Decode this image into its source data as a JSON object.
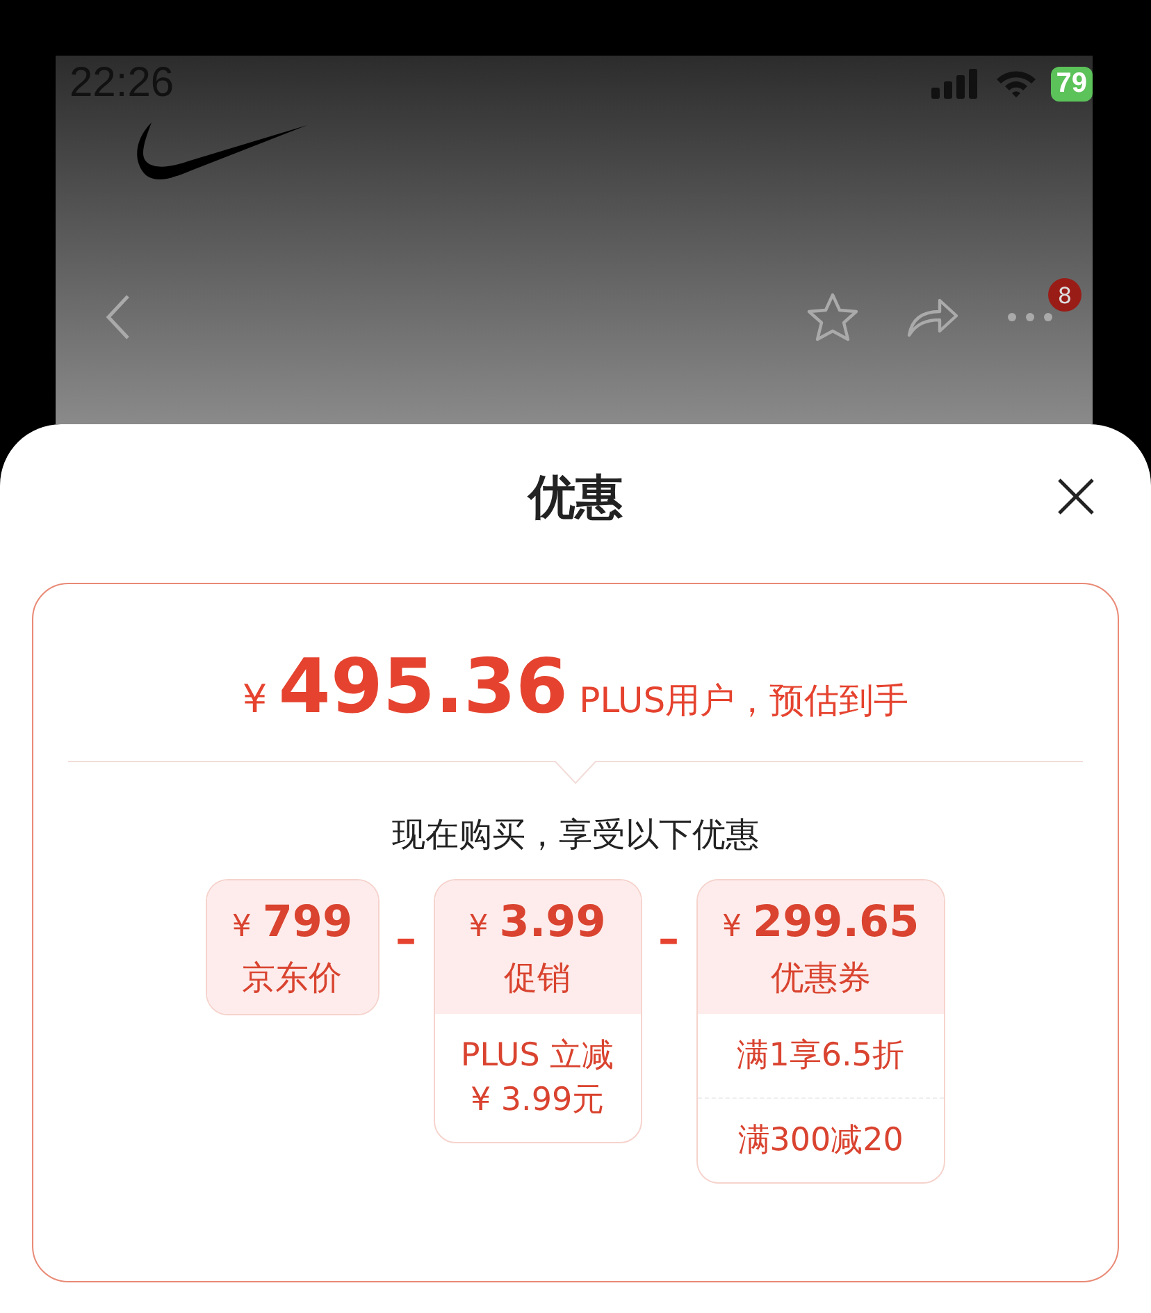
{
  "status_bar": {
    "time": "22:26",
    "battery": "79"
  },
  "nav": {
    "badge": "8"
  },
  "sheet": {
    "title": "优惠",
    "price": {
      "currency": "¥",
      "amount": "495.36",
      "note": "PLUS用户，预估到手"
    },
    "subtitle": "现在购买，享受以下优惠",
    "items": [
      {
        "currency": "¥",
        "amount": "799",
        "label": "京东价"
      },
      {
        "operator": "–",
        "currency": "¥",
        "amount": "3.99",
        "label": "促销",
        "details": [
          {
            "lines": [
              "PLUS 立减",
              "¥ 3.99元"
            ]
          }
        ]
      },
      {
        "operator": "–",
        "currency": "¥",
        "amount": "299.65",
        "label": "优惠券",
        "details": [
          {
            "lines": [
              "满1享6.5折"
            ]
          },
          {
            "lines": [
              "满300减20"
            ]
          }
        ]
      }
    ]
  }
}
